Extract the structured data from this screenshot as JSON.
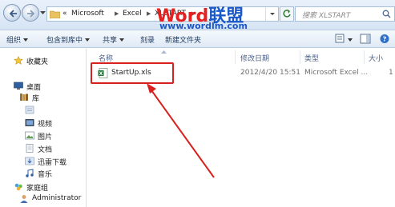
{
  "address": {
    "prefix": "«",
    "crumbs": [
      "Microsoft",
      "Excel",
      "XLSTART"
    ]
  },
  "search": {
    "placeholder": "搜索 XLSTART"
  },
  "toolbar": {
    "organize": "组织",
    "include_in_library": "包含到库中",
    "share": "共享",
    "burn": "刻录",
    "new_folder": "新建文件夹"
  },
  "sidebar": {
    "items": [
      {
        "label": "收藏夹",
        "icon": "star-icon"
      },
      {
        "label": "桌面",
        "icon": "desktop-icon"
      },
      {
        "label": "库",
        "icon": "library-icon"
      },
      {
        "label": "",
        "icon": "generic-library-icon"
      },
      {
        "label": "视频",
        "icon": "video-icon"
      },
      {
        "label": "图片",
        "icon": "picture-icon"
      },
      {
        "label": "文档",
        "icon": "document-icon"
      },
      {
        "label": "迅雷下载",
        "icon": "download-icon"
      },
      {
        "label": "音乐",
        "icon": "music-icon"
      },
      {
        "label": "家庭组",
        "icon": "homegroup-icon"
      },
      {
        "label": "Administrator",
        "icon": "user-icon"
      }
    ]
  },
  "columns": {
    "name": "名称",
    "modified": "修改日期",
    "type": "类型",
    "size": "大小"
  },
  "files": [
    {
      "name": "StartUp.xls",
      "modified": "2012/4/20 15:51",
      "type": "Microsoft Excel ...",
      "size": "1"
    }
  ],
  "watermark": {
    "logo_a": "Word",
    "logo_b": "联盟",
    "url": "www.wordlm.com"
  },
  "colors": {
    "highlight": "#d8211f",
    "watermark_red": "#e42020",
    "watermark_blue": "#1b58c8"
  }
}
